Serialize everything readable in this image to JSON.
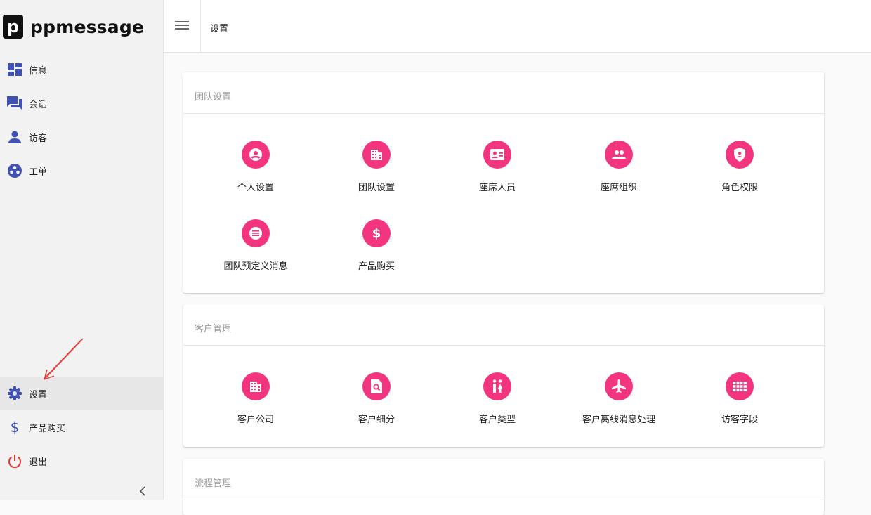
{
  "brand": {
    "logo_letter": "p",
    "name": "ppmessage"
  },
  "sidebar": {
    "items": [
      {
        "label": "信息",
        "icon": "dashboard-icon"
      },
      {
        "label": "会话",
        "icon": "chat-icon"
      },
      {
        "label": "访客",
        "icon": "person-icon"
      },
      {
        "label": "工单",
        "icon": "ticket-icon"
      }
    ],
    "bottom_items": [
      {
        "label": "设置",
        "icon": "gear-icon",
        "active": true
      },
      {
        "label": "产品购买",
        "icon": "dollar-icon"
      },
      {
        "label": "退出",
        "icon": "power-icon"
      }
    ],
    "collapse_icon": "chevron-left-icon"
  },
  "header": {
    "title": "设置"
  },
  "sections": [
    {
      "title": "团队设置",
      "tiles": [
        {
          "label": "个人设置",
          "icon": "account-circle-icon"
        },
        {
          "label": "团队设置",
          "icon": "building-icon"
        },
        {
          "label": "座席人员",
          "icon": "contact-card-icon"
        },
        {
          "label": "座席组织",
          "icon": "group-icon"
        },
        {
          "label": "角色权限",
          "icon": "shield-icon"
        },
        {
          "label": "团队预定义消息",
          "icon": "list-icon"
        },
        {
          "label": "产品购买",
          "icon": "dollar-icon"
        }
      ]
    },
    {
      "title": "客户管理",
      "tiles": [
        {
          "label": "客户公司",
          "icon": "building-icon"
        },
        {
          "label": "客户细分",
          "icon": "document-search-icon"
        },
        {
          "label": "客户类型",
          "icon": "people-icon"
        },
        {
          "label": "客户离线消息处理",
          "icon": "airplane-icon"
        },
        {
          "label": "访客字段",
          "icon": "grid-icon"
        }
      ]
    },
    {
      "title": "流程管理",
      "tiles": []
    }
  ],
  "colors": {
    "accent": "#f3357f",
    "nav_icon": "#3f51b5",
    "logout_icon": "#e53935"
  }
}
